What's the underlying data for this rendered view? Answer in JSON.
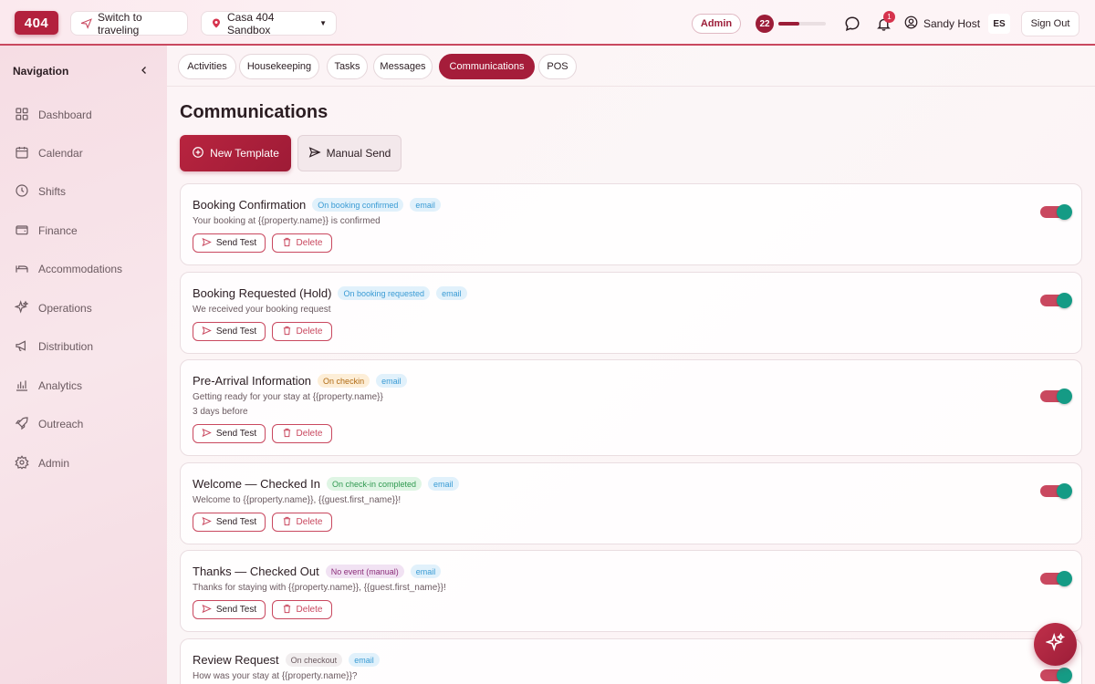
{
  "header": {
    "logo": "404",
    "switch_label": "Switch to traveling",
    "property_label": "Casa 404 Sandbox",
    "role_badge": "Admin",
    "level": "22",
    "level_progress": 0.45,
    "notifications_count": "1",
    "user_name": "Sandy Host",
    "language": "ES",
    "sign_out_label": "Sign Out"
  },
  "sidebar": {
    "title": "Navigation",
    "items": [
      {
        "label": "Dashboard",
        "icon": "grid-icon"
      },
      {
        "label": "Calendar",
        "icon": "calendar-icon"
      },
      {
        "label": "Shifts",
        "icon": "clock-icon"
      },
      {
        "label": "Finance",
        "icon": "wallet-icon"
      },
      {
        "label": "Accommodations",
        "icon": "bed-icon"
      },
      {
        "label": "Operations",
        "icon": "sparkles-icon"
      },
      {
        "label": "Distribution",
        "icon": "megaphone-icon"
      },
      {
        "label": "Analytics",
        "icon": "bar-chart-icon"
      },
      {
        "label": "Outreach",
        "icon": "rocket-icon"
      },
      {
        "label": "Admin",
        "icon": "gear-icon"
      }
    ]
  },
  "tabs": [
    {
      "label": "Activities"
    },
    {
      "label": "Housekeeping"
    },
    {
      "label": "Tasks"
    },
    {
      "label": "Messages"
    },
    {
      "label": "Communications",
      "active": true
    },
    {
      "label": "POS"
    }
  ],
  "main": {
    "title": "Communications",
    "new_template_label": "New Template",
    "manual_send_label": "Manual Send"
  },
  "templates": [
    {
      "title": "Booking Confirmation",
      "trigger": "On booking confirmed",
      "channel": "email",
      "description": "Your booking at {{property.name}} is confirmed",
      "extra": "",
      "enabled": true
    },
    {
      "title": "Booking Requested (Hold)",
      "trigger": "On booking requested",
      "channel": "email",
      "description": "We received your booking request",
      "extra": "",
      "enabled": true
    },
    {
      "title": "Pre-Arrival Information",
      "trigger": "On checkin",
      "channel": "email",
      "description": "Getting ready for your stay at {{property.name}}",
      "extra": "3 days before",
      "enabled": true
    },
    {
      "title": "Welcome — Checked In",
      "trigger": "On check-in completed",
      "channel": "email",
      "description": "Welcome to {{property.name}}, {{guest.first_name}}!",
      "extra": "",
      "enabled": true
    },
    {
      "title": "Thanks — Checked Out",
      "trigger": "No event (manual)",
      "channel": "email",
      "description": "Thanks for staying with {{property.name}}, {{guest.first_name}}!",
      "extra": "",
      "enabled": true
    },
    {
      "title": "Review Request",
      "trigger": "On checkout",
      "channel": "email",
      "description": "How was your stay at {{property.name}}?",
      "extra": "",
      "enabled": true
    }
  ],
  "card_actions": {
    "send_test_label": "Send Test",
    "delete_label": "Delete"
  },
  "colors": {
    "brand": "#a51d3a",
    "toggle_on_knob": "#159b85",
    "toggle_track": "#c9485f"
  }
}
